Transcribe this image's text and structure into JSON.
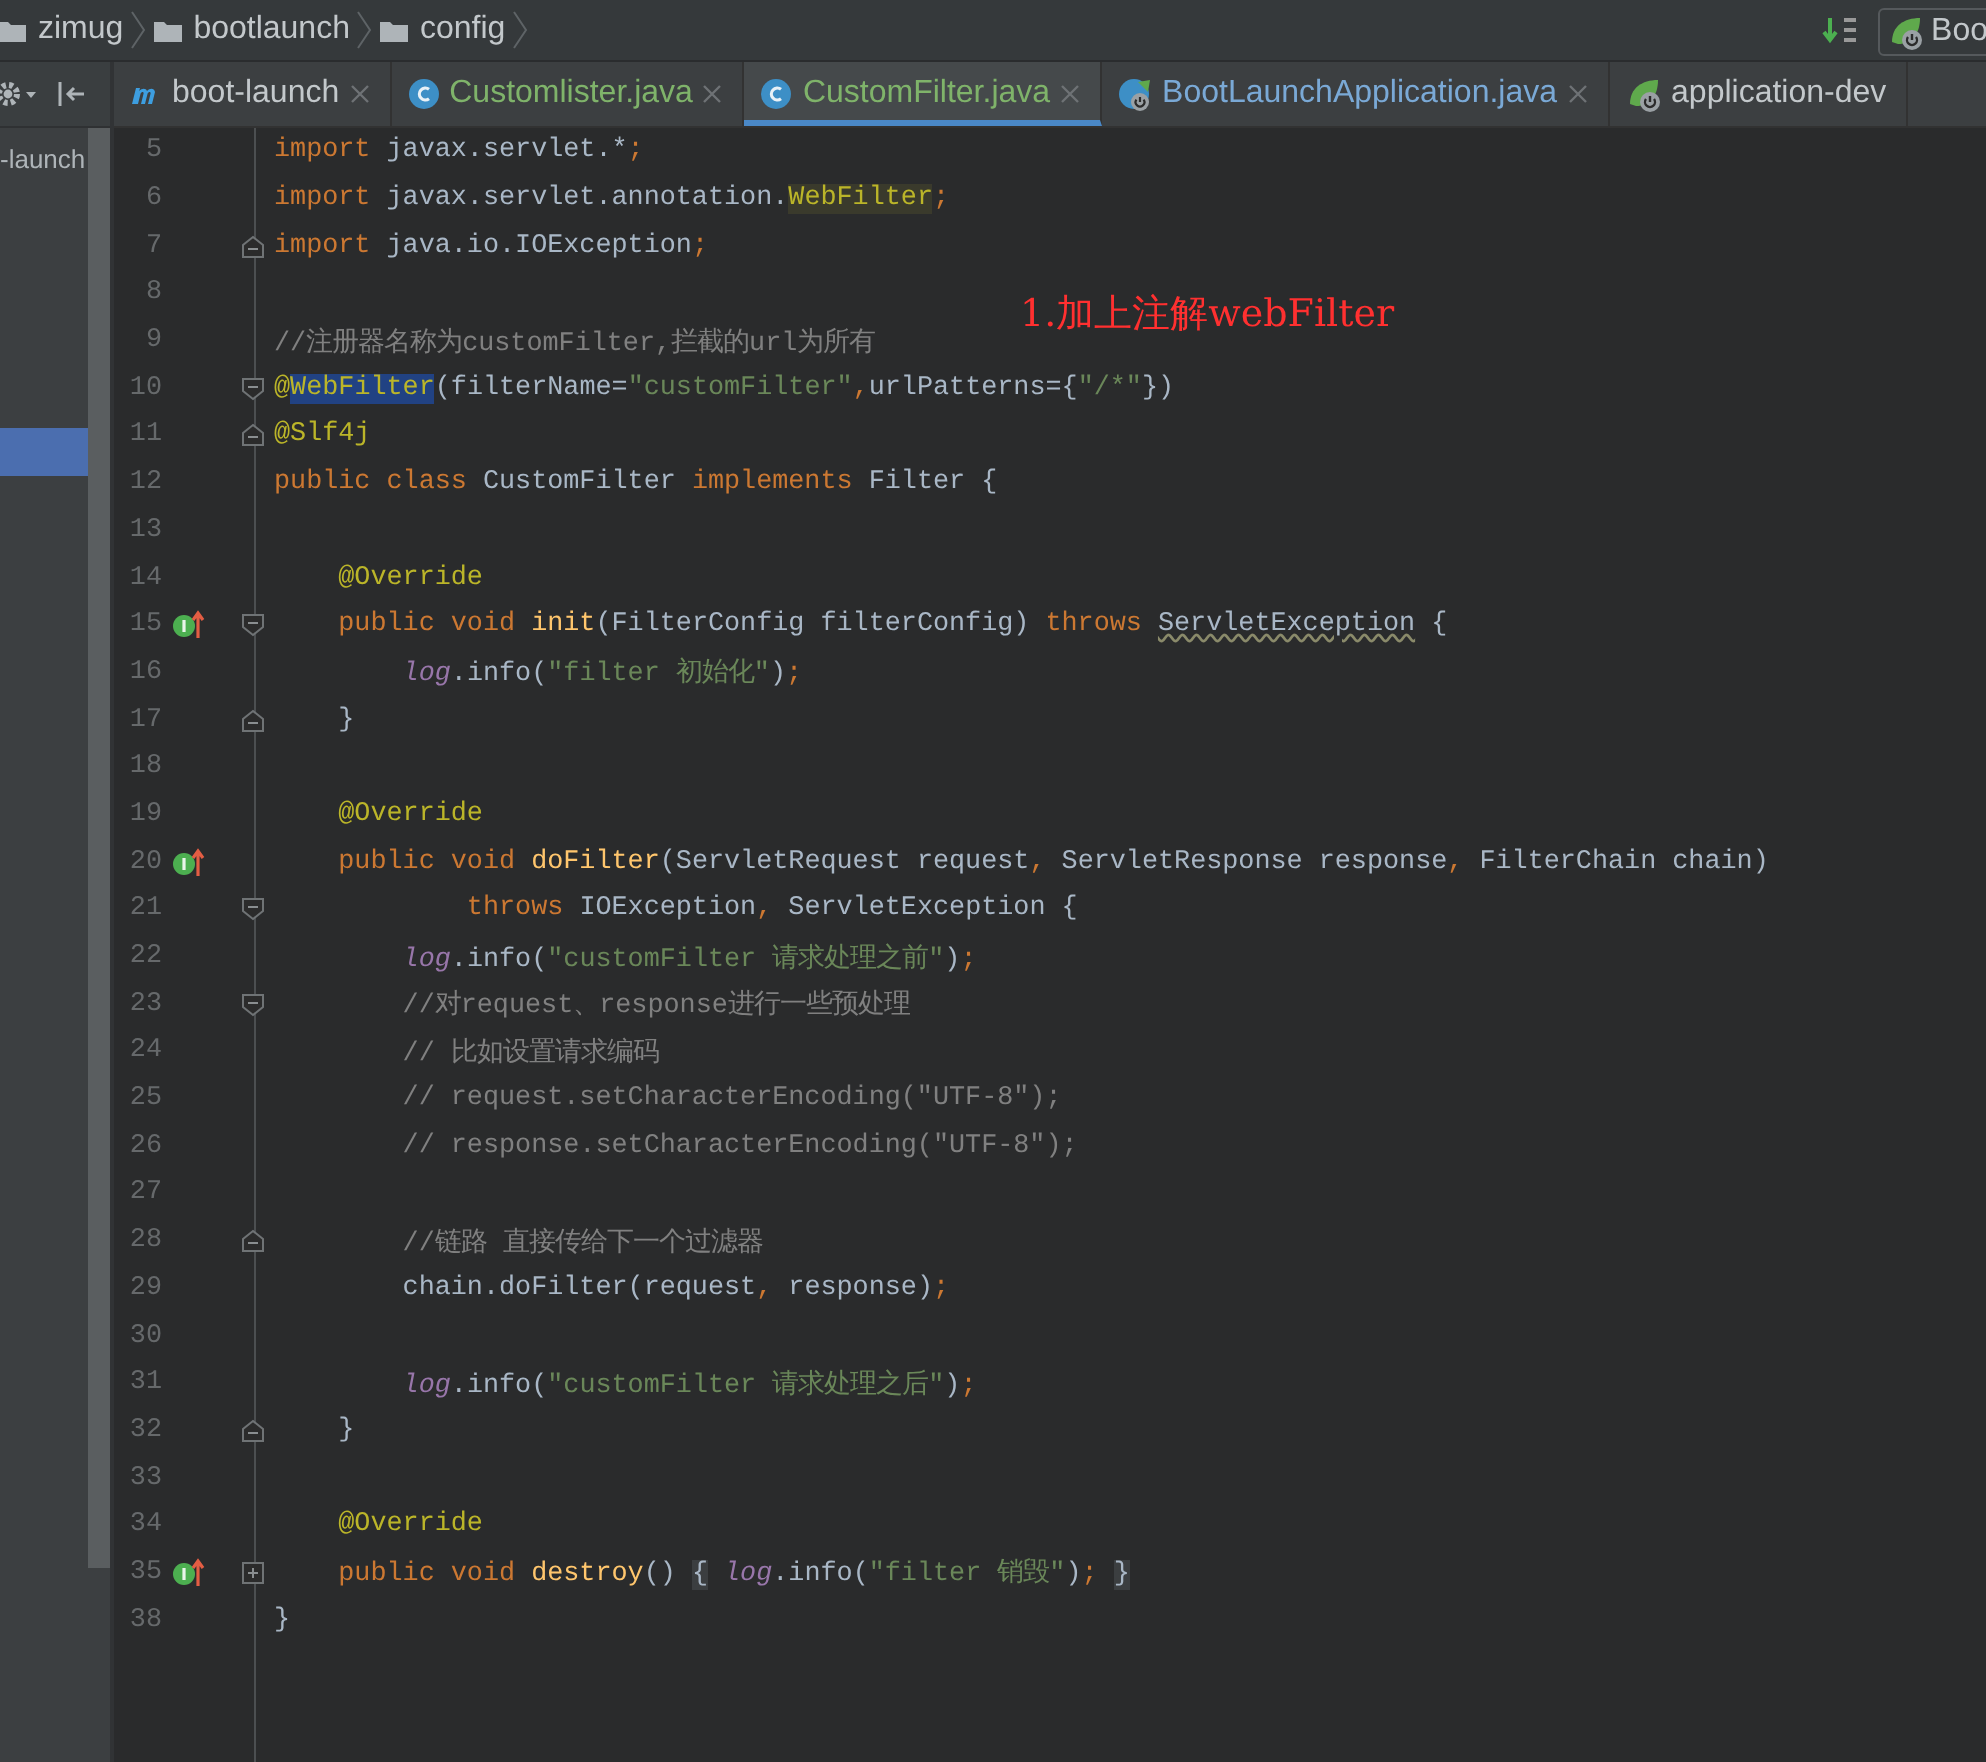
{
  "breadcrumbs": [
    "zimug",
    "bootlaunch",
    "config"
  ],
  "run_config": {
    "label": "Boo"
  },
  "project_panel": {
    "items": [
      {
        "label": "-launch",
        "selected": false
      },
      {
        "selected": true
      }
    ]
  },
  "tabs": [
    {
      "label": "boot-launch",
      "kind": "module",
      "color": "#c3c8cb",
      "closable": true,
      "selected": false
    },
    {
      "label": "Customlister.java",
      "kind": "class",
      "color": "#7fb36a",
      "closable": true,
      "selected": false
    },
    {
      "label": "CustomFilter.java",
      "kind": "class",
      "color": "#7fb36a",
      "closable": true,
      "selected": true
    },
    {
      "label": "BootLaunchApplication.java",
      "kind": "app",
      "color": "#7aa9d6",
      "closable": true,
      "selected": false
    },
    {
      "label": "application-dev",
      "kind": "config",
      "color": "#c3c8cb",
      "closable": false,
      "selected": false
    }
  ],
  "editor": {
    "callout": "1.加上注解webFilter",
    "lines": [
      {
        "number": "5",
        "tokens": [
          {
            "kind": "kw",
            "text": "import"
          },
          {
            "kind": "txt",
            "text": " javax.servlet.*"
          },
          {
            "kind": "punc",
            "text": ";"
          }
        ]
      },
      {
        "number": "6",
        "tokens": [
          {
            "kind": "kw",
            "text": "import"
          },
          {
            "kind": "txt",
            "text": " javax.servlet.annotation."
          },
          {
            "kind": "hl",
            "text": "WebFilter"
          },
          {
            "kind": "punc",
            "text": ";"
          }
        ]
      },
      {
        "number": "7",
        "fold": {
          "kind": "end"
        },
        "tokens": [
          {
            "kind": "kw",
            "text": "import"
          },
          {
            "kind": "txt",
            "text": " java.io.IOException"
          },
          {
            "kind": "punc",
            "text": ";"
          }
        ]
      },
      {
        "number": "8"
      },
      {
        "number": "9",
        "tokens": [
          {
            "kind": "cmt",
            "text": "//注册器名称为customFilter,拦截的url为所有"
          }
        ]
      },
      {
        "number": "10",
        "fold": {
          "kind": "start"
        },
        "tokens": [
          {
            "kind": "ann",
            "text": "@"
          },
          {
            "kind": "sel",
            "text": "WebFilter"
          },
          {
            "kind": "txt",
            "text": "(filterName="
          },
          {
            "kind": "str",
            "text": "\"customFilter\""
          },
          {
            "kind": "punc",
            "text": ","
          },
          {
            "kind": "txt",
            "text": "urlPatterns={"
          },
          {
            "kind": "str",
            "text": "\"/*\""
          },
          {
            "kind": "txt",
            "text": "})"
          }
        ]
      },
      {
        "number": "11",
        "fold": {
          "kind": "end"
        },
        "tokens": [
          {
            "kind": "ann",
            "text": "@Slf4j"
          }
        ]
      },
      {
        "number": "12",
        "tokens": [
          {
            "kind": "kw",
            "text": "public class "
          },
          {
            "kind": "txt",
            "text": "CustomFilter "
          },
          {
            "kind": "kw",
            "text": "implements "
          },
          {
            "kind": "txt",
            "text": "Filter {"
          }
        ]
      },
      {
        "number": "13"
      },
      {
        "number": "14",
        "tokens": [
          {
            "kind": "ann",
            "text": "    @Override"
          }
        ]
      },
      {
        "number": "15",
        "marker": {
          "kind": "implements"
        },
        "fold": {
          "kind": "start"
        },
        "tokens": [
          {
            "kind": "kw",
            "text": "    public void "
          },
          {
            "kind": "fn",
            "text": "init"
          },
          {
            "kind": "txt",
            "text": "(FilterConfig filterConfig) "
          },
          {
            "kind": "kw",
            "text": "throws "
          },
          {
            "kind": "warn",
            "text": "ServletException"
          },
          {
            "kind": "txt",
            "text": " {"
          }
        ]
      },
      {
        "number": "16",
        "tokens": [
          {
            "kind": "fld",
            "text": "        log"
          },
          {
            "kind": "txt",
            "text": ".info("
          },
          {
            "kind": "str",
            "text": "\"filter 初始化\""
          },
          {
            "kind": "txt",
            "text": ")"
          },
          {
            "kind": "punc",
            "text": ";"
          }
        ]
      },
      {
        "number": "17",
        "fold": {
          "kind": "end"
        },
        "tokens": [
          {
            "kind": "txt",
            "text": "    }"
          }
        ]
      },
      {
        "number": "18"
      },
      {
        "number": "19",
        "tokens": [
          {
            "kind": "ann",
            "text": "    @Override"
          }
        ]
      },
      {
        "number": "20",
        "marker": {
          "kind": "implements"
        },
        "tokens": [
          {
            "kind": "kw",
            "text": "    public void "
          },
          {
            "kind": "fn",
            "text": "doFilter"
          },
          {
            "kind": "txt",
            "text": "(ServletRequest request"
          },
          {
            "kind": "punc",
            "text": ", "
          },
          {
            "kind": "txt",
            "text": "ServletResponse response"
          },
          {
            "kind": "punc",
            "text": ", "
          },
          {
            "kind": "txt",
            "text": "FilterChain chain)"
          }
        ]
      },
      {
        "number": "21",
        "fold": {
          "kind": "start"
        },
        "tokens": [
          {
            "kind": "kw",
            "text": "            throws "
          },
          {
            "kind": "txt",
            "text": "IOException"
          },
          {
            "kind": "punc",
            "text": ", "
          },
          {
            "kind": "txt",
            "text": "ServletException {"
          }
        ]
      },
      {
        "number": "22",
        "tokens": [
          {
            "kind": "fld",
            "text": "        log"
          },
          {
            "kind": "txt",
            "text": ".info("
          },
          {
            "kind": "str",
            "text": "\"customFilter 请求处理之前\""
          },
          {
            "kind": "txt",
            "text": ")"
          },
          {
            "kind": "punc",
            "text": ";"
          }
        ]
      },
      {
        "number": "23",
        "fold": {
          "kind": "start"
        },
        "tokens": [
          {
            "kind": "cmt",
            "text": "        //对request、response进行一些预处理"
          }
        ]
      },
      {
        "number": "24",
        "tokens": [
          {
            "kind": "cmt",
            "text": "        // 比如设置请求编码"
          }
        ]
      },
      {
        "number": "25",
        "tokens": [
          {
            "kind": "cmt",
            "text": "        // request.setCharacterEncoding(\"UTF-8\");"
          }
        ]
      },
      {
        "number": "26",
        "tokens": [
          {
            "kind": "cmt",
            "text": "        // response.setCharacterEncoding(\"UTF-8\");"
          }
        ]
      },
      {
        "number": "27"
      },
      {
        "number": "28",
        "fold": {
          "kind": "end"
        },
        "tokens": [
          {
            "kind": "cmt",
            "text": "        //链路 直接传给下一个过滤器"
          }
        ]
      },
      {
        "number": "29",
        "tokens": [
          {
            "kind": "txt",
            "text": "        chain.doFilter(request"
          },
          {
            "kind": "punc",
            "text": ", "
          },
          {
            "kind": "txt",
            "text": "response)"
          },
          {
            "kind": "punc",
            "text": ";"
          }
        ]
      },
      {
        "number": "30"
      },
      {
        "number": "31",
        "tokens": [
          {
            "kind": "fld",
            "text": "        log"
          },
          {
            "kind": "txt",
            "text": ".info("
          },
          {
            "kind": "str",
            "text": "\"customFilter 请求处理之后\""
          },
          {
            "kind": "txt",
            "text": ")"
          },
          {
            "kind": "punc",
            "text": ";"
          }
        ]
      },
      {
        "number": "32",
        "fold": {
          "kind": "end"
        },
        "tokens": [
          {
            "kind": "txt",
            "text": "    }"
          }
        ]
      },
      {
        "number": "33"
      },
      {
        "number": "34",
        "tokens": [
          {
            "kind": "ann",
            "text": "    @Override"
          }
        ]
      },
      {
        "number": "35",
        "marker": {
          "kind": "implements"
        },
        "fold": {
          "kind": "collapsed"
        },
        "tokens": [
          {
            "kind": "kw",
            "text": "    public void "
          },
          {
            "kind": "fn",
            "text": "destroy"
          },
          {
            "kind": "txt",
            "text": "() "
          },
          {
            "kind": "fb",
            "text": "{"
          },
          {
            "kind": "fld",
            "text": " log"
          },
          {
            "kind": "txt",
            "text": ".info("
          },
          {
            "kind": "str",
            "text": "\"filter 销毁\""
          },
          {
            "kind": "txt",
            "text": ")"
          },
          {
            "kind": "punc",
            "text": "; "
          },
          {
            "kind": "fb",
            "text": "}"
          }
        ]
      },
      {
        "number": "38",
        "tokens": [
          {
            "kind": "txt",
            "text": "}"
          }
        ]
      }
    ]
  }
}
